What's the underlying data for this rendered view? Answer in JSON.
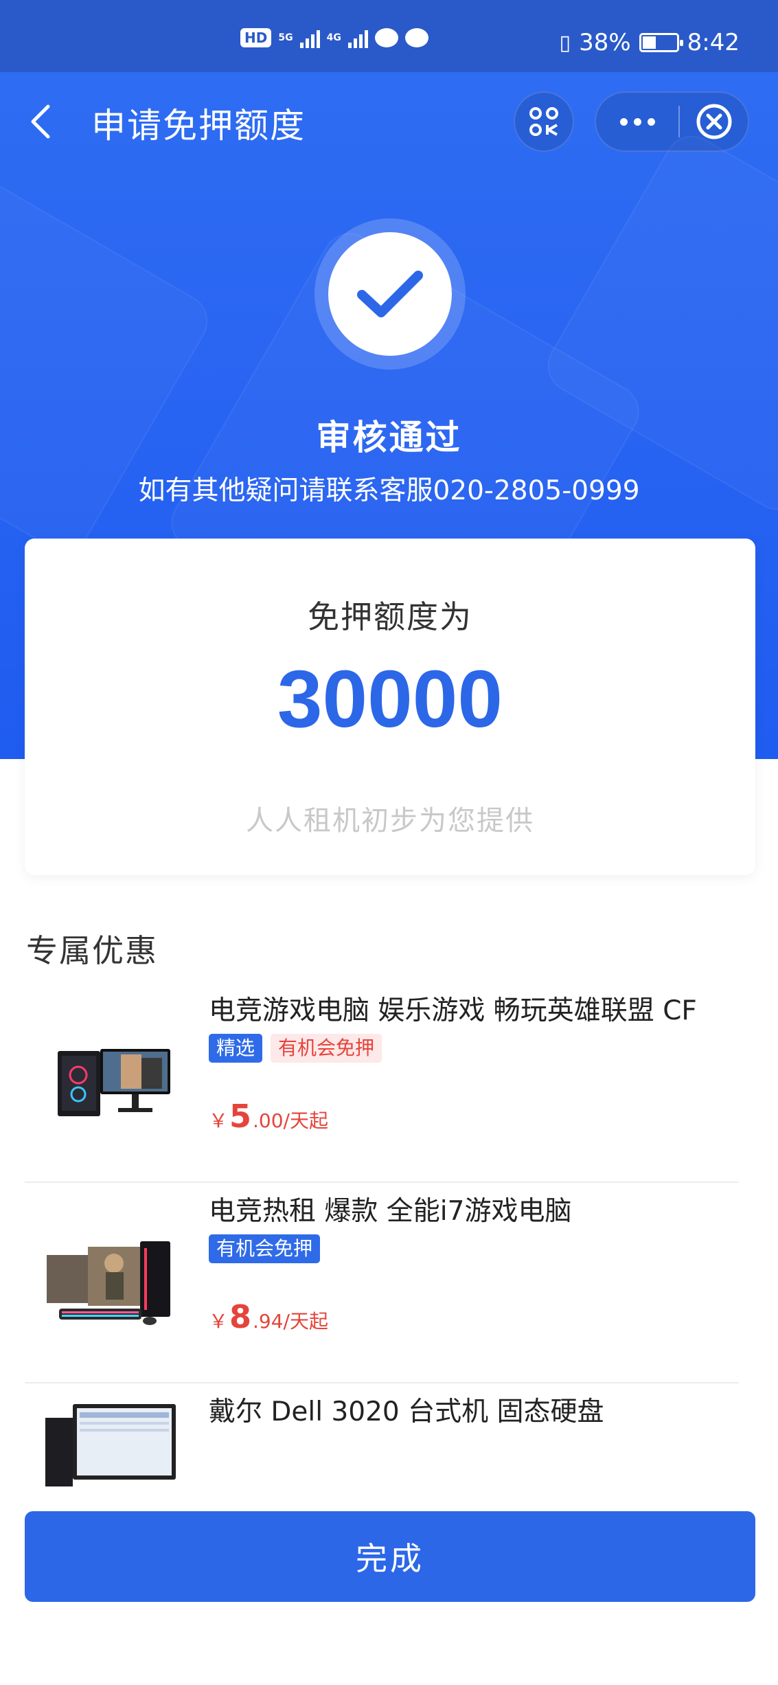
{
  "status_bar": {
    "hd": "HD",
    "net1": "5G",
    "net2": "4G",
    "battery": "38%",
    "time": "8:42"
  },
  "nav": {
    "title": "申请免押额度"
  },
  "result": {
    "title": "审核通过",
    "subtitle": "如有其他疑问请联系客服020-2805-0999"
  },
  "card": {
    "label": "免押额度为",
    "amount": "30000",
    "note": "人人租机初步为您提供"
  },
  "section": {
    "title": "专属优惠"
  },
  "products": [
    {
      "title": "电竞游戏电脑 娱乐游戏 畅玩英雄联盟 CF",
      "tags": [
        "精选",
        "有机会免押"
      ],
      "currency": "￥",
      "price_int": "5",
      "price_rest": ".00/天起"
    },
    {
      "title": "电竞热租 爆款 全能i7游戏电脑",
      "tags": [
        "有机会免押"
      ],
      "currency": "￥",
      "price_int": "8",
      "price_rest": ".94/天起"
    },
    {
      "title": "戴尔 Dell 3020 台式机 固态硬盘"
    }
  ],
  "button": {
    "done": "完成"
  },
  "colors": {
    "primary": "#2c67e8",
    "price": "#e5443b",
    "tag_pink_bg": "#fde9e9"
  }
}
